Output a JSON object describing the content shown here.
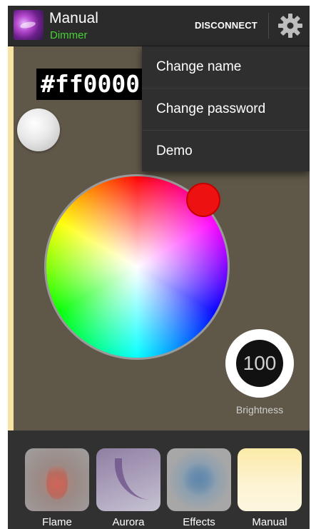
{
  "app": {
    "title": "Manual",
    "subtitle": "Dimmer",
    "icon": "app-logo-icon"
  },
  "toolbar": {
    "disconnect_label": "DISCONNECT",
    "settings_icon": "gear-icon"
  },
  "menu": {
    "items": [
      {
        "label": "Change name"
      },
      {
        "label": "Change password"
      },
      {
        "label": "Demo"
      }
    ]
  },
  "color": {
    "hex": "#ff0000",
    "selected": "#ff0000"
  },
  "brightness": {
    "value": "100",
    "label": "Brightness"
  },
  "tabs": [
    {
      "label": "Flame",
      "icon": "flame-icon"
    },
    {
      "label": "Aurora",
      "icon": "aurora-icon"
    },
    {
      "label": "Effects",
      "icon": "effects-icon"
    },
    {
      "label": "Manual",
      "icon": "manual-icon",
      "active": true
    }
  ],
  "colors": {
    "accent_green": "#47d236",
    "manual_accent": "#f8e3a3",
    "toolbar_bg": "#2b2b2b"
  }
}
